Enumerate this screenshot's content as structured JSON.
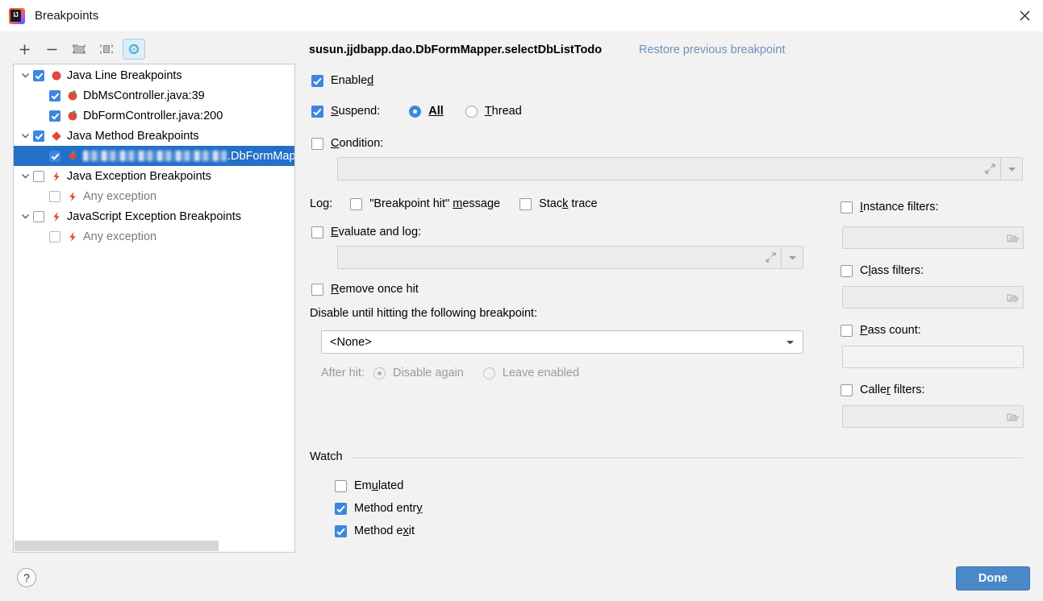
{
  "window": {
    "title": "Breakpoints",
    "app_icon": "intellij-idea-icon",
    "close_icon": "close-icon"
  },
  "toolbar": {
    "add": "+",
    "remove": "−",
    "icons": [
      "add-breakpoint-icon",
      "remove-breakpoint-icon",
      "move-to-group-icon",
      "set-group-icon",
      "mute-breakpoints-icon"
    ]
  },
  "tree": {
    "items": [
      {
        "label": "Java Line Breakpoints",
        "checked": true,
        "expanded": true,
        "indent": 0,
        "icon": "red-circle-breakpoint-icon",
        "dim": false
      },
      {
        "label": "DbMsController.java:39",
        "checked": true,
        "expanded": null,
        "indent": 1,
        "icon": "line-breakpoint-tick-icon",
        "dim": false
      },
      {
        "label": "DbFormController.java:200",
        "checked": true,
        "expanded": null,
        "indent": 1,
        "icon": "line-breakpoint-tick-icon",
        "dim": false
      },
      {
        "label": "Java Method Breakpoints",
        "checked": true,
        "expanded": true,
        "indent": 0,
        "icon": "red-diamond-breakpoint-icon",
        "dim": false
      },
      {
        "label": ".DbFormMapper",
        "checked": true,
        "expanded": null,
        "indent": 1,
        "icon": "method-breakpoint-icon",
        "dim": false,
        "selected": true,
        "redacted_prefix": true
      },
      {
        "label": "Java Exception Breakpoints",
        "checked": false,
        "expanded": true,
        "indent": 0,
        "icon": "exception-bolt-icon",
        "dim": false
      },
      {
        "label": "Any exception",
        "checked": false,
        "expanded": null,
        "indent": 1,
        "icon": "exception-bolt-icon",
        "dim": true
      },
      {
        "label": "JavaScript Exception Breakpoints",
        "checked": false,
        "expanded": true,
        "indent": 0,
        "icon": "exception-bolt-icon",
        "dim": false
      },
      {
        "label": "Any exception",
        "checked": false,
        "expanded": null,
        "indent": 1,
        "icon": "exception-bolt-icon",
        "dim": true
      }
    ]
  },
  "detail": {
    "title": "susun.jjdbapp.dao.DbFormMapper.selectDbListTodo",
    "restore_link": "Restore previous breakpoint",
    "enabled": {
      "label": "Enabled",
      "mnemonic": "d",
      "checked": true
    },
    "suspend": {
      "label": "Suspend:",
      "mnemonic": "S",
      "checked": true,
      "options": [
        "All",
        "Thread"
      ],
      "selected": "All"
    },
    "condition": {
      "label": "Condition:",
      "mnemonic": "C",
      "checked": false,
      "value": "",
      "expand_icon": "expand-editor-icon",
      "dropdown_icon": "chevron-down-icon"
    },
    "log": {
      "prefix": "Log:",
      "breakpoint_hit": {
        "label": "\"Breakpoint hit\" message",
        "mnemonic": "m",
        "checked": false
      },
      "stack_trace": {
        "label": "Stack trace",
        "mnemonic": "k",
        "checked": false
      }
    },
    "evaluate_and_log": {
      "label": "Evaluate and log:",
      "mnemonic": "E",
      "checked": false,
      "value": "",
      "expand_icon": "expand-editor-icon",
      "dropdown_icon": "chevron-down-icon"
    },
    "remove_once_hit": {
      "label": "Remove once hit",
      "mnemonic": "R",
      "checked": false
    },
    "disable_until": {
      "label": "Disable until hitting the following breakpoint:",
      "selected": "<None>",
      "options": [
        "<None>"
      ]
    },
    "after_hit": {
      "label": "After hit:",
      "options": [
        "Disable again",
        "Leave enabled"
      ],
      "selected": "Disable again",
      "disabled": true
    },
    "watch": {
      "title": "Watch",
      "items": [
        {
          "label": "Emulated",
          "mnemonic": "u",
          "checked": false
        },
        {
          "label": "Method entry",
          "mnemonic": "y",
          "checked": true
        },
        {
          "label": "Method exit",
          "mnemonic": "x",
          "checked": true
        }
      ]
    },
    "filters": [
      {
        "label": "Instance filters:",
        "mnemonic": "I",
        "checked": false,
        "value": "",
        "browse_icon": "folder-icon"
      },
      {
        "label": "Class filters:",
        "mnemonic": "l",
        "checked": false,
        "value": "",
        "browse_icon": "folder-icon"
      },
      {
        "label": "Pass count:",
        "mnemonic": "P",
        "checked": false,
        "value": "",
        "browse_icon": null
      },
      {
        "label": "Caller filters:",
        "mnemonic": "r",
        "checked": false,
        "value": "",
        "browse_icon": "folder-icon"
      }
    ]
  },
  "footer": {
    "help_label": "?",
    "done_label": "Done"
  },
  "colors": {
    "accent": "#3d86e0",
    "selection": "#2470c9",
    "dialog_bg": "#f2f2f2",
    "link": "#6b93bd",
    "breakpoint_red": "#e0483c",
    "done_button": "#4a88c7"
  }
}
